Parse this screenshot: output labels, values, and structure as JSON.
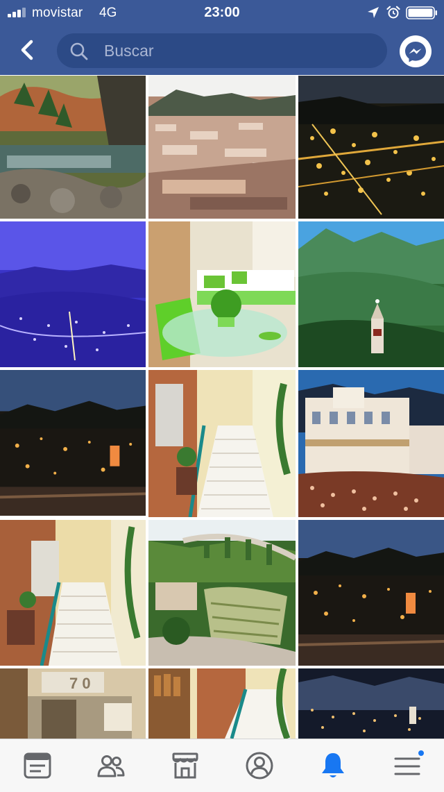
{
  "status_bar": {
    "carrier": "movistar",
    "network": "4G",
    "time": "23:00",
    "signal_bars": 3,
    "icons": [
      "signal-icon",
      "location-arrow-icon",
      "alarm-icon",
      "battery-icon"
    ]
  },
  "header": {
    "back_icon": "chevron-left-icon",
    "search": {
      "placeholder": "Buscar",
      "value": "",
      "icon": "search-icon"
    },
    "messenger_icon": "messenger-icon"
  },
  "photos": [
    {
      "subject": "river-valley-pines"
    },
    {
      "subject": "town-aerial-day"
    },
    {
      "subject": "town-night-lights"
    },
    {
      "subject": "town-night-blue"
    },
    {
      "subject": "hotel-room-green"
    },
    {
      "subject": "mountains-church-tower"
    },
    {
      "subject": "town-dusk-skyline"
    },
    {
      "subject": "staircase-plant"
    },
    {
      "subject": "festival-square-crowd"
    },
    {
      "subject": "staircase-railing"
    },
    {
      "subject": "bridge-aqueduct-gorge"
    },
    {
      "subject": "town-dusk-skyline-2"
    },
    {
      "subject": "room-number-70"
    },
    {
      "subject": "staircase-library"
    },
    {
      "subject": "town-night-hills"
    }
  ],
  "tab_bar": {
    "tabs": [
      {
        "name": "news-feed",
        "icon": "news-feed-icon",
        "active": false
      },
      {
        "name": "friends",
        "icon": "friends-icon",
        "active": false
      },
      {
        "name": "marketplace",
        "icon": "marketplace-icon",
        "active": false
      },
      {
        "name": "profile",
        "icon": "profile-icon",
        "active": false
      },
      {
        "name": "notifications",
        "icon": "bell-icon",
        "active": true
      },
      {
        "name": "menu",
        "icon": "hamburger-menu-icon",
        "active": false,
        "badge": true
      }
    ],
    "active_color": "#1877f2",
    "inactive_color": "#65676b"
  },
  "colors": {
    "brand_blue": "#3b5998",
    "search_field": "#2c4a86"
  }
}
